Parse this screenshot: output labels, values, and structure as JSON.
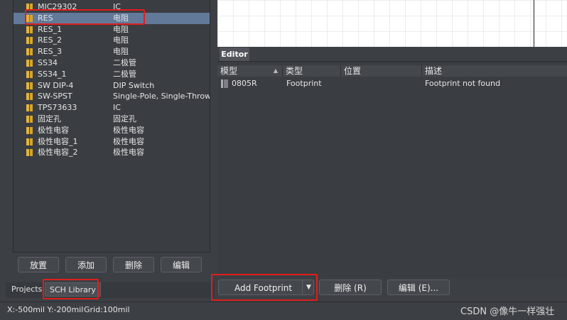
{
  "components": [
    {
      "name": "MIC29302",
      "desc": "IC"
    },
    {
      "name": "RES",
      "desc": "电阻",
      "selected": true
    },
    {
      "name": "RES_1",
      "desc": "电阻"
    },
    {
      "name": "RES_2",
      "desc": "电阻"
    },
    {
      "name": "RES_3",
      "desc": "电阻"
    },
    {
      "name": "SS34",
      "desc": "二极管"
    },
    {
      "name": "SS34_1",
      "desc": "二极管"
    },
    {
      "name": "SW DIP-4",
      "desc": "DIP Switch"
    },
    {
      "name": "SW-SPST",
      "desc": "Single-Pole, Single-Throw"
    },
    {
      "name": "TPS73633",
      "desc": "IC"
    },
    {
      "name": "固定孔",
      "desc": "固定孔"
    },
    {
      "name": "极性电容",
      "desc": "极性电容"
    },
    {
      "name": "极性电容_1",
      "desc": "极性电容"
    },
    {
      "name": "极性电容_2",
      "desc": "极性电容"
    }
  ],
  "left_buttons": {
    "place": "放置",
    "add": "添加",
    "delete": "删除",
    "edit": "编辑"
  },
  "panel_tabs": {
    "projects": "Projects",
    "sch_library": "SCH Library"
  },
  "editor": {
    "tab_label": "Editor",
    "columns": [
      "模型",
      "类型",
      "位置",
      "描述"
    ],
    "rows": [
      {
        "model": "0805R",
        "type": "Footprint",
        "location": "",
        "desc": "Footprint not found"
      }
    ]
  },
  "editor_buttons": {
    "add_footprint": "Add Footprint",
    "delete": "删除 (R)",
    "edit": "编辑 (E)..."
  },
  "status": {
    "coords": "X:-500mil Y:-200mil",
    "grid": "Grid:100mil"
  },
  "watermark": "CSDN @像牛一样强壮",
  "colors": {
    "selection": "#62799a",
    "highlight_box": "#e01e1e",
    "component_icon": "#e5b53a"
  }
}
